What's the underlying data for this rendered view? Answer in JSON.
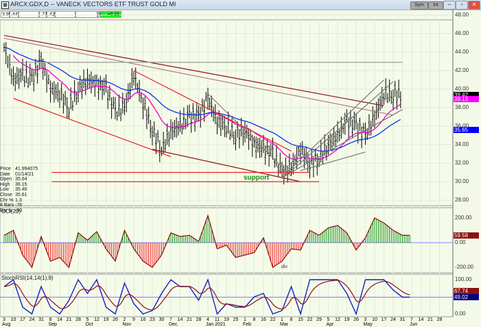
{
  "window": {
    "title": "ARCX:GDX,D -- VANECK VECTORS ETF TRUST GOLD MI",
    "buttons": [
      "Sym",
      "Int"
    ],
    "icons": [
      "minimize-icon",
      "maximize-icon",
      "close-icon"
    ]
  },
  "toolbar": {
    "fields": [
      "3.99",
      ".44",
      "",
      ".77",
      ".42",
      "",
      "",
      "N",
      "+0.21"
    ],
    "change_color": "#22ee22"
  },
  "info_box": [
    {
      "k": "Price",
      "v": "41.994075"
    },
    {
      "k": "Date",
      "v": "01/14/21"
    },
    {
      "k": "Open",
      "v": "35.64"
    },
    {
      "k": "High",
      "v": "36.15"
    },
    {
      "k": "Low",
      "v": "35.46"
    },
    {
      "k": "Close",
      "v": "35.61"
    },
    {
      "k": "Chr %",
      "v": "1.3"
    },
    {
      "k": "# Bars",
      "v": "-76"
    },
    {
      "k": "Bar Ix",
      "v": "-93"
    }
  ],
  "annotation": "support",
  "chart_data": [
    {
      "type": "line",
      "panel": "price",
      "style": "ohlc-bars",
      "ylim": [
        27,
        48.5
      ],
      "yticks": [
        "48.00",
        "46.00",
        "44.00",
        "42.00",
        "40.00",
        "38.00",
        "36.00",
        "34.00",
        "32.00",
        "30.00",
        "28.00"
      ],
      "week_start": [
        "2020-08-03",
        "2020-08-10",
        "2020-08-17",
        "2020-08-24",
        "2020-08-31",
        "2020-09-08",
        "2020-09-14",
        "2020-09-21",
        "2020-09-28",
        "2020-10-05",
        "2020-10-12",
        "2020-10-19",
        "2020-10-26",
        "2020-11-02",
        "2020-11-09",
        "2020-11-16",
        "2020-11-23",
        "2020-11-30",
        "2020-12-07",
        "2020-12-14",
        "2020-12-21",
        "2020-12-28",
        "2021-01-04",
        "2021-01-11",
        "2021-01-19",
        "2021-01-25",
        "2021-02-01",
        "2021-02-08",
        "2021-02-16",
        "2021-02-22",
        "2021-03-01",
        "2021-03-08",
        "2021-03-15",
        "2021-03-22",
        "2021-03-29",
        "2021-04-05",
        "2021-04-12",
        "2021-04-19",
        "2021-04-26",
        "2021-05-03",
        "2021-05-10",
        "2021-05-17",
        "2021-05-24"
      ],
      "close": [
        44.5,
        41.0,
        41.5,
        41.0,
        43.0,
        40.0,
        39.5,
        38.0,
        40.0,
        41.0,
        40.5,
        40.0,
        37.5,
        38.0,
        41.5,
        38.5,
        35.5,
        33.5,
        35.5,
        36.0,
        37.0,
        37.0,
        39.0,
        36.5,
        36.0,
        35.0,
        35.5,
        34.0,
        33.5,
        33.0,
        31.0,
        31.5,
        33.5,
        32.0,
        32.5,
        34.0,
        35.0,
        36.5,
        36.0,
        35.0,
        37.0,
        39.5,
        39.42
      ],
      "last_labels": [
        {
          "text": "39.42",
          "bg": "#000000",
          "fg": "#ffffff"
        },
        {
          "text": "39.13",
          "bg": "#ff00ff",
          "fg": "#ffffff"
        },
        {
          "text": "35.65",
          "bg": "#0000ff",
          "fg": "#ffffff"
        }
      ],
      "moving_averages": [
        {
          "color": "#ee00cc"
        },
        {
          "color": "#1030e0"
        }
      ],
      "trendlines": [
        {
          "from": [
            "2020-08-03",
            45.8
          ],
          "to": [
            "2021-05-17",
            38.2
          ],
          "color": "#8b1010"
        },
        {
          "from": [
            "2020-08-03",
            45.5
          ],
          "to": [
            "2021-05-24",
            37.2
          ],
          "color": "#b08080"
        },
        {
          "from": [
            "2020-08-10",
            39.0
          ],
          "to": [
            "2020-12-07",
            32.7
          ],
          "color": "#ee2020"
        },
        {
          "from": [
            "2020-11-09",
            42.0
          ],
          "to": [
            "2021-03-08",
            33.3
          ],
          "color": "#ee2020"
        },
        {
          "from": [
            "2020-11-23",
            33.5
          ],
          "to": [
            "2021-03-15",
            30.0
          ],
          "color": "#8b1010"
        },
        {
          "from": [
            "2021-01-04",
            39.5
          ],
          "to": [
            "2021-03-08",
            30.6
          ],
          "color": "#8a7a7a"
        },
        {
          "from": [
            "2021-03-01",
            30.5
          ],
          "to": [
            "2021-05-17",
            41.0
          ],
          "color": "#777777"
        },
        {
          "from": [
            "2021-03-01",
            30.3
          ],
          "to": [
            "2021-05-24",
            40.8
          ],
          "color": "#777777"
        },
        {
          "from": [
            "2021-03-08",
            31.0
          ],
          "to": [
            "2021-05-31",
            37.8
          ],
          "color": "#777777"
        },
        {
          "from": [
            "2021-03-15",
            31.2
          ],
          "to": [
            "2021-05-03",
            33.2
          ],
          "color": "#777777"
        },
        {
          "from": [
            "2020-09-08",
            31.0
          ],
          "to": [
            "2021-03-22",
            31.0
          ],
          "color": "#ee2020"
        },
        {
          "from": [
            "2020-09-08",
            30.0
          ],
          "to": [
            "2021-03-29",
            30.0
          ],
          "color": "#ee2020"
        },
        {
          "from": [
            "2020-08-03",
            42.9
          ],
          "to": [
            "2021-05-31",
            42.9
          ],
          "color": "#999999"
        }
      ]
    },
    {
      "type": "area",
      "panel": "cci",
      "title": "CCI(20)",
      "ylim": [
        -280,
        260
      ],
      "yticks": [
        "200.00",
        "0.00",
        "-200.00"
      ],
      "values": [
        60,
        100,
        -100,
        -200,
        50,
        -150,
        -120,
        -200,
        80,
        20,
        90,
        -50,
        -150,
        100,
        -50,
        -150,
        -200,
        -100,
        80,
        50,
        60,
        10,
        220,
        -50,
        -20,
        -120,
        -100,
        -80,
        40,
        -200,
        -150,
        -50,
        -60,
        100,
        60,
        120,
        140,
        80,
        -60,
        40,
        200,
        160,
        100,
        59.58
      ],
      "last_label": {
        "text": "59.58",
        "bg": "#8b1010"
      },
      "annotation": "div",
      "pos_color": "#109010",
      "neg_color": "#ee2020"
    },
    {
      "type": "line",
      "panel": "stochrsi",
      "title": "StochRSI(14,14(1),9)",
      "ylim": [
        -5,
        110
      ],
      "yticks": [
        "100.00",
        "0.00"
      ],
      "values": [
        80,
        100,
        20,
        0,
        80,
        20,
        0,
        40,
        100,
        60,
        100,
        20,
        0,
        90,
        30,
        0,
        10,
        60,
        100,
        80,
        80,
        40,
        100,
        0,
        30,
        20,
        20,
        50,
        60,
        0,
        10,
        80,
        0,
        100,
        100,
        100,
        100,
        60,
        0,
        100,
        100,
        100,
        70,
        49.02
      ],
      "last_labels": [
        {
          "text": "67.74",
          "bg": "#8b1010"
        },
        {
          "text": "49.02",
          "bg": "#000080"
        }
      ],
      "colors": {
        "k": "#1020c0",
        "signal": "#8b1010"
      }
    }
  ],
  "x_axis": {
    "ticks": [
      "3",
      "10",
      "17",
      "24",
      "31",
      "8",
      "14",
      "21",
      "28",
      "5",
      "12",
      "19",
      "26",
      "2",
      "9",
      "16",
      "23",
      "30",
      "7",
      "14",
      "21",
      "28",
      "4",
      "11",
      "19",
      "25",
      "1",
      "8",
      "16",
      "22",
      "1",
      "8",
      "15",
      "22",
      "29",
      "5",
      "12",
      "19",
      "26",
      "3",
      "10",
      "17",
      "24",
      "31",
      "7",
      "14",
      "21",
      "28"
    ],
    "months": [
      {
        "label": "Aug",
        "tick": 0
      },
      {
        "label": "Sep",
        "tick": 5
      },
      {
        "label": "Oct",
        "tick": 9
      },
      {
        "label": "Nov",
        "tick": 13
      },
      {
        "label": "Dec",
        "tick": 18
      },
      {
        "label": "Jan 2021",
        "tick": 22
      },
      {
        "label": "Feb",
        "tick": 26
      },
      {
        "label": "Mar",
        "tick": 30
      },
      {
        "label": "Apr",
        "tick": 35
      },
      {
        "label": "May",
        "tick": 39
      },
      {
        "label": "Jun",
        "tick": 44
      }
    ]
  }
}
